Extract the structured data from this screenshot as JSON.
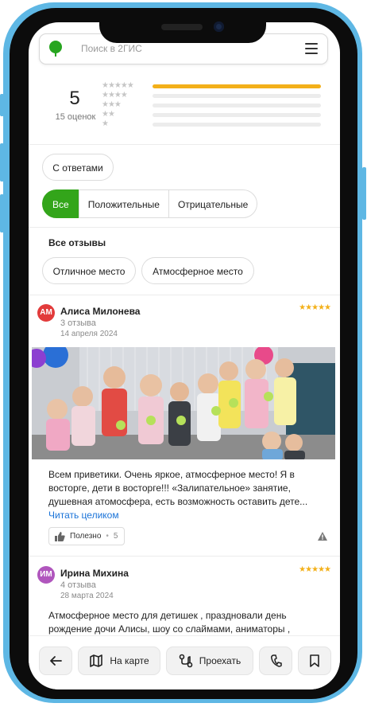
{
  "search": {
    "placeholder": "Поиск в 2ГИС"
  },
  "rating": {
    "score": "5",
    "count_label": "15 оценок",
    "distribution": [
      {
        "stars": "★★★★★",
        "fraction": 1.0
      },
      {
        "stars": "★★★★",
        "fraction": 0
      },
      {
        "stars": "★★★",
        "fraction": 0
      },
      {
        "stars": "★★",
        "fraction": 0
      },
      {
        "stars": "★",
        "fraction": 0
      }
    ]
  },
  "filters": {
    "with_answers": "С ответами",
    "tabs": [
      "Все",
      "Положительные",
      "Отрицательные"
    ],
    "active_tab": "Все"
  },
  "all_reviews_title": "Все отзывы",
  "tags": [
    "Отличное место",
    "Атмосферное место"
  ],
  "reviews": [
    {
      "initials": "АМ",
      "avatar_color": "#e23b3b",
      "author": "Алиса Милонева",
      "review_count": "3 отзыва",
      "date": "14 апреля 2024",
      "stars": "★★★★★",
      "text": "Всем приветики. Очень яркое, атмосферное место! Я в восторге, дети в восторге!!! «Залипательное» занятие, душевная атомосфера, есть возможность оставить дете...",
      "read_more": "Читать целиком",
      "helpful_label": "Полезно",
      "helpful_count": "5"
    },
    {
      "initials": "ИМ",
      "avatar_color": "#b056bd",
      "author": "Ирина Михина",
      "review_count": "4 отзыва",
      "date": "28 марта 2024",
      "stars": "★★★★★",
      "text": "Атмосферное место для детишек , праздновали день рождение дочи Алисы, шоу со слаймами, аниматоры , мусика, весело. Дети были в таком восторге, не"
    }
  ],
  "bottom_bar": {
    "map_label": "На карте",
    "route_label": "Проехать"
  },
  "colors": {
    "accent_green": "#33a51a",
    "star": "#f3b019",
    "link": "#1a73d8",
    "phone_frame": "#5eb7e4"
  }
}
